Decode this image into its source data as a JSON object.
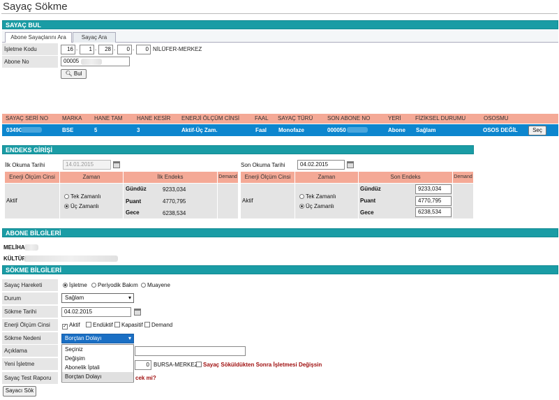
{
  "page": {
    "title": "Sayaç Sökme"
  },
  "sayac_bul": {
    "header": "SAYAÇ BUL",
    "tabs": [
      "Abone Sayaçlarını Ara",
      "Sayaç Ara"
    ],
    "isletme_label": "İşletme Kodu",
    "isletme_codes": [
      "16",
      "1",
      "28",
      "0",
      "0"
    ],
    "isletme_name": "NİLÜFER-MERKEZ",
    "abone_no_label": "Abone No",
    "abone_no_value": "00005",
    "bul_button": "Bul"
  },
  "meter_table": {
    "headers": [
      "SAYAÇ SERİ NO",
      "MARKA",
      "HANE TAM",
      "HANE KESİR",
      "ENERJİ ÖLÇÜM CİNSİ",
      "FAAL",
      "SAYAÇ TÜRÜ",
      "SON ABONE NO",
      "YERİ",
      "FİZİKSEL DURUMU",
      "OSOSMU"
    ],
    "row": [
      "0349C",
      "BSE",
      "5",
      "3",
      "Aktif-Üç Zam.",
      "Faal",
      "Monofaze",
      "000050",
      "Abone",
      "Sağlam",
      "OSOS DEĞİL"
    ],
    "select_button": "Seç"
  },
  "endeks": {
    "header": "ENDEKS GİRİŞİ",
    "left": {
      "date_label": "İlk Okuma Tarihi",
      "date_value": "14.01.2015",
      "col_headers": [
        "Enerji Ölçüm Cinsi",
        "Zaman",
        "İlk Endeks",
        "Demand"
      ],
      "type": "Aktif",
      "radios": [
        "Tek Zamanlı",
        "Üç Zamanlı"
      ],
      "rows": [
        {
          "label": "Gündüz",
          "value": "9233,034"
        },
        {
          "label": "Puant",
          "value": "4770,795"
        },
        {
          "label": "Gece",
          "value": "6238,534"
        }
      ]
    },
    "right": {
      "date_label": "Son Okuma Tarihi",
      "date_value": "04.02.2015",
      "col_headers": [
        "Enerji Ölçüm Cinsi",
        "Zaman",
        "Son Endeks",
        "Demand"
      ],
      "type": "Aktif",
      "radios": [
        "Tek Zamanlı",
        "Üç Zamanlı"
      ],
      "rows": [
        {
          "label": "Gündüz",
          "value": "9233,034"
        },
        {
          "label": "Puant",
          "value": "4770,795"
        },
        {
          "label": "Gece",
          "value": "6238,534"
        }
      ]
    }
  },
  "abone": {
    "header": "ABONE BİLGİLERİ",
    "name_prefix": "MELİHA",
    "address_prefix": "KÜLTÜR"
  },
  "sokme": {
    "header": "SÖKME BİLGİLERİ",
    "hareket_label": "Sayaç Hareketi",
    "hareket_options": [
      "İşletme",
      "Periyodik Bakım",
      "Muayene"
    ],
    "durum_label": "Durum",
    "durum_value": "Sağlam",
    "tarih_label": "Sökme Tarihi",
    "tarih_value": "04.02.2015",
    "enerji_label": "Enerji Ölçüm Cinsi",
    "enerji_options": [
      "Aktif",
      "Endüktif",
      "Kapasitif",
      "Demand"
    ],
    "neden_label": "Sökme Nedeni",
    "neden_value": "Borçtan Dolayı",
    "neden_options": [
      "Seçiniz",
      "Değişim",
      "Abonelik İptali",
      "Borçtan Dolayı"
    ],
    "aciklama_label": "Açıklama",
    "yeni_isletme_label": "Yeni İşletme",
    "yeni_isletme_code": "0",
    "yeni_isletme_name": "BURSA-MERKEZ",
    "yeni_isletme_check": "Sayaç Söküldükten Sonra İşletmesi Değişsin",
    "test_raporu_label": "Sayaç Test Raporu",
    "test_raporu_question": "cek mi?",
    "submit_button": "Sayacı Sök"
  },
  "colors": {
    "section_bar": "#1a9ca5",
    "table_header": "#f4a996",
    "selected_row": "#0d86ce"
  }
}
